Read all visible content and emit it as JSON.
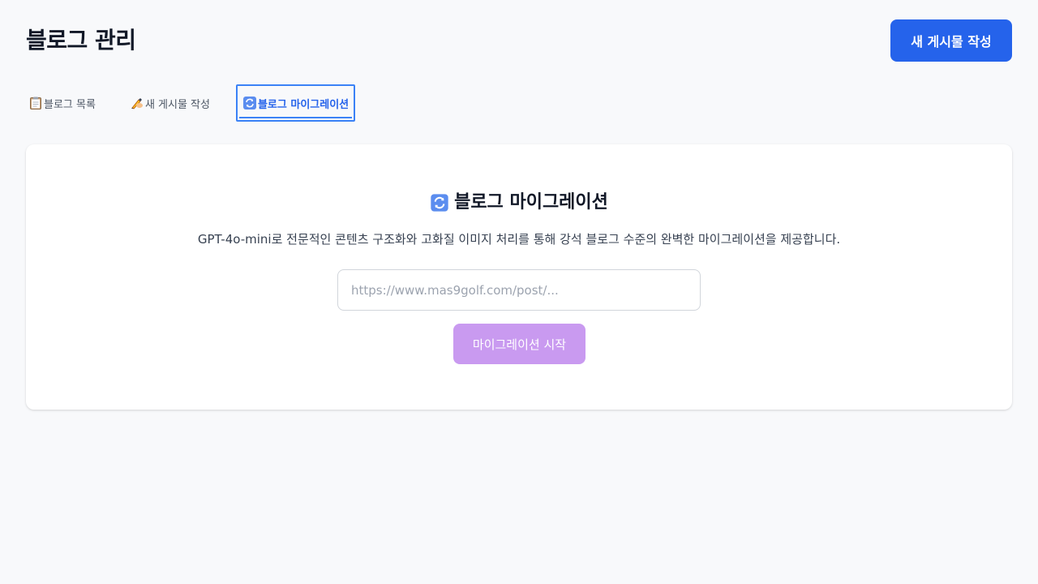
{
  "header": {
    "title": "블로그 관리",
    "new_post_button": "새 게시물 작성",
    "accent_color": "#2563eb"
  },
  "tabs": [
    {
      "icon": "clipboard-icon",
      "label": "블로그 목록",
      "active": false
    },
    {
      "icon": "writing-hand-icon",
      "label": "새 게시물 작성",
      "active": false
    },
    {
      "icon": "refresh-icon",
      "label": "블로그 마이그레이션",
      "active": true
    }
  ],
  "migration": {
    "icon": "refresh-icon",
    "title": "블로그 마이그레이션",
    "description": "GPT-4o-mini로 전문적인 콘텐츠 구조화와 고화질 이미지 처리를 통해 강석 블로그 수준의 완벽한 마이그레이션을 제공합니다.",
    "url_input": {
      "value": "",
      "placeholder": "https://www.mas9golf.com/post/..."
    },
    "start_button": "마이그레이션 시작",
    "start_button_color": "#c99af0"
  }
}
